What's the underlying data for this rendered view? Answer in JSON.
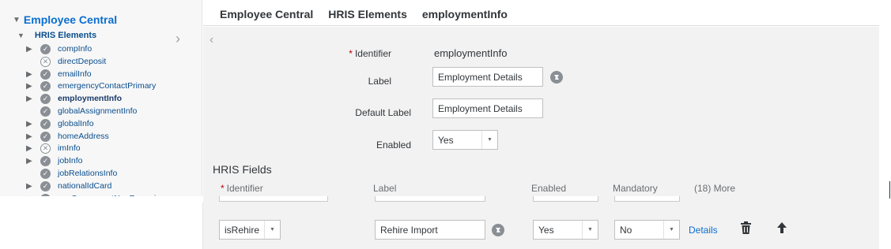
{
  "tree": {
    "root": "Employee Central",
    "sub": "HRIS Elements",
    "items": [
      {
        "label": "compInfo",
        "status": "enabled",
        "expandable": true
      },
      {
        "label": "directDeposit",
        "status": "disabled",
        "expandable": false
      },
      {
        "label": "emailInfo",
        "status": "enabled",
        "expandable": true
      },
      {
        "label": "emergencyContactPrimary",
        "status": "enabled",
        "expandable": true
      },
      {
        "label": "employmentInfo",
        "status": "enabled",
        "expandable": true,
        "selected": true
      },
      {
        "label": "globalAssignmentInfo",
        "status": "enabled",
        "expandable": false
      },
      {
        "label": "globalInfo",
        "status": "enabled",
        "expandable": true
      },
      {
        "label": "homeAddress",
        "status": "enabled",
        "expandable": true
      },
      {
        "label": "imInfo",
        "status": "disabled",
        "expandable": true
      },
      {
        "label": "jobInfo",
        "status": "enabled",
        "expandable": true
      },
      {
        "label": "jobRelationsInfo",
        "status": "enabled",
        "expandable": false
      },
      {
        "label": "nationalIdCard",
        "status": "enabled",
        "expandable": true
      },
      {
        "label": "payComponentNonRecurring",
        "status": "enabled",
        "expandable": true
      }
    ]
  },
  "breadcrumb": [
    "Employee Central",
    "HRIS Elements",
    "employmentInfo"
  ],
  "form": {
    "required_mark": "*",
    "identifier_label": "Identifier",
    "identifier_value": "employmentInfo",
    "label_label": "Label",
    "label_value": "Employment Details",
    "default_label_label": "Default Label",
    "default_label_value": "Employment Details",
    "enabled_label": "Enabled",
    "enabled_value": "Yes"
  },
  "hris_fields": {
    "title": "HRIS Fields",
    "columns": {
      "identifier": "Identifier",
      "label": "Label",
      "enabled": "Enabled",
      "mandatory": "Mandatory",
      "more": "(18) More"
    },
    "row": {
      "identifier": "isRehire",
      "label": "Rehire Import",
      "enabled": "Yes",
      "mandatory": "No",
      "details": "Details"
    }
  },
  "icons": {
    "collapse": "triangle-down-icon",
    "expand": "triangle-right-icon",
    "enabled": "check-circle-icon",
    "disabled": "x-circle-icon",
    "translate": "globe-icon",
    "delete": "trash-icon",
    "move_up": "arrow-up-icon",
    "back": "chevron-left-icon"
  },
  "colors": {
    "accent": "#0a6ed1",
    "tree_text": "#0a4e8e",
    "panel_bg": "#f2f2f2",
    "required": "#bb0000"
  }
}
